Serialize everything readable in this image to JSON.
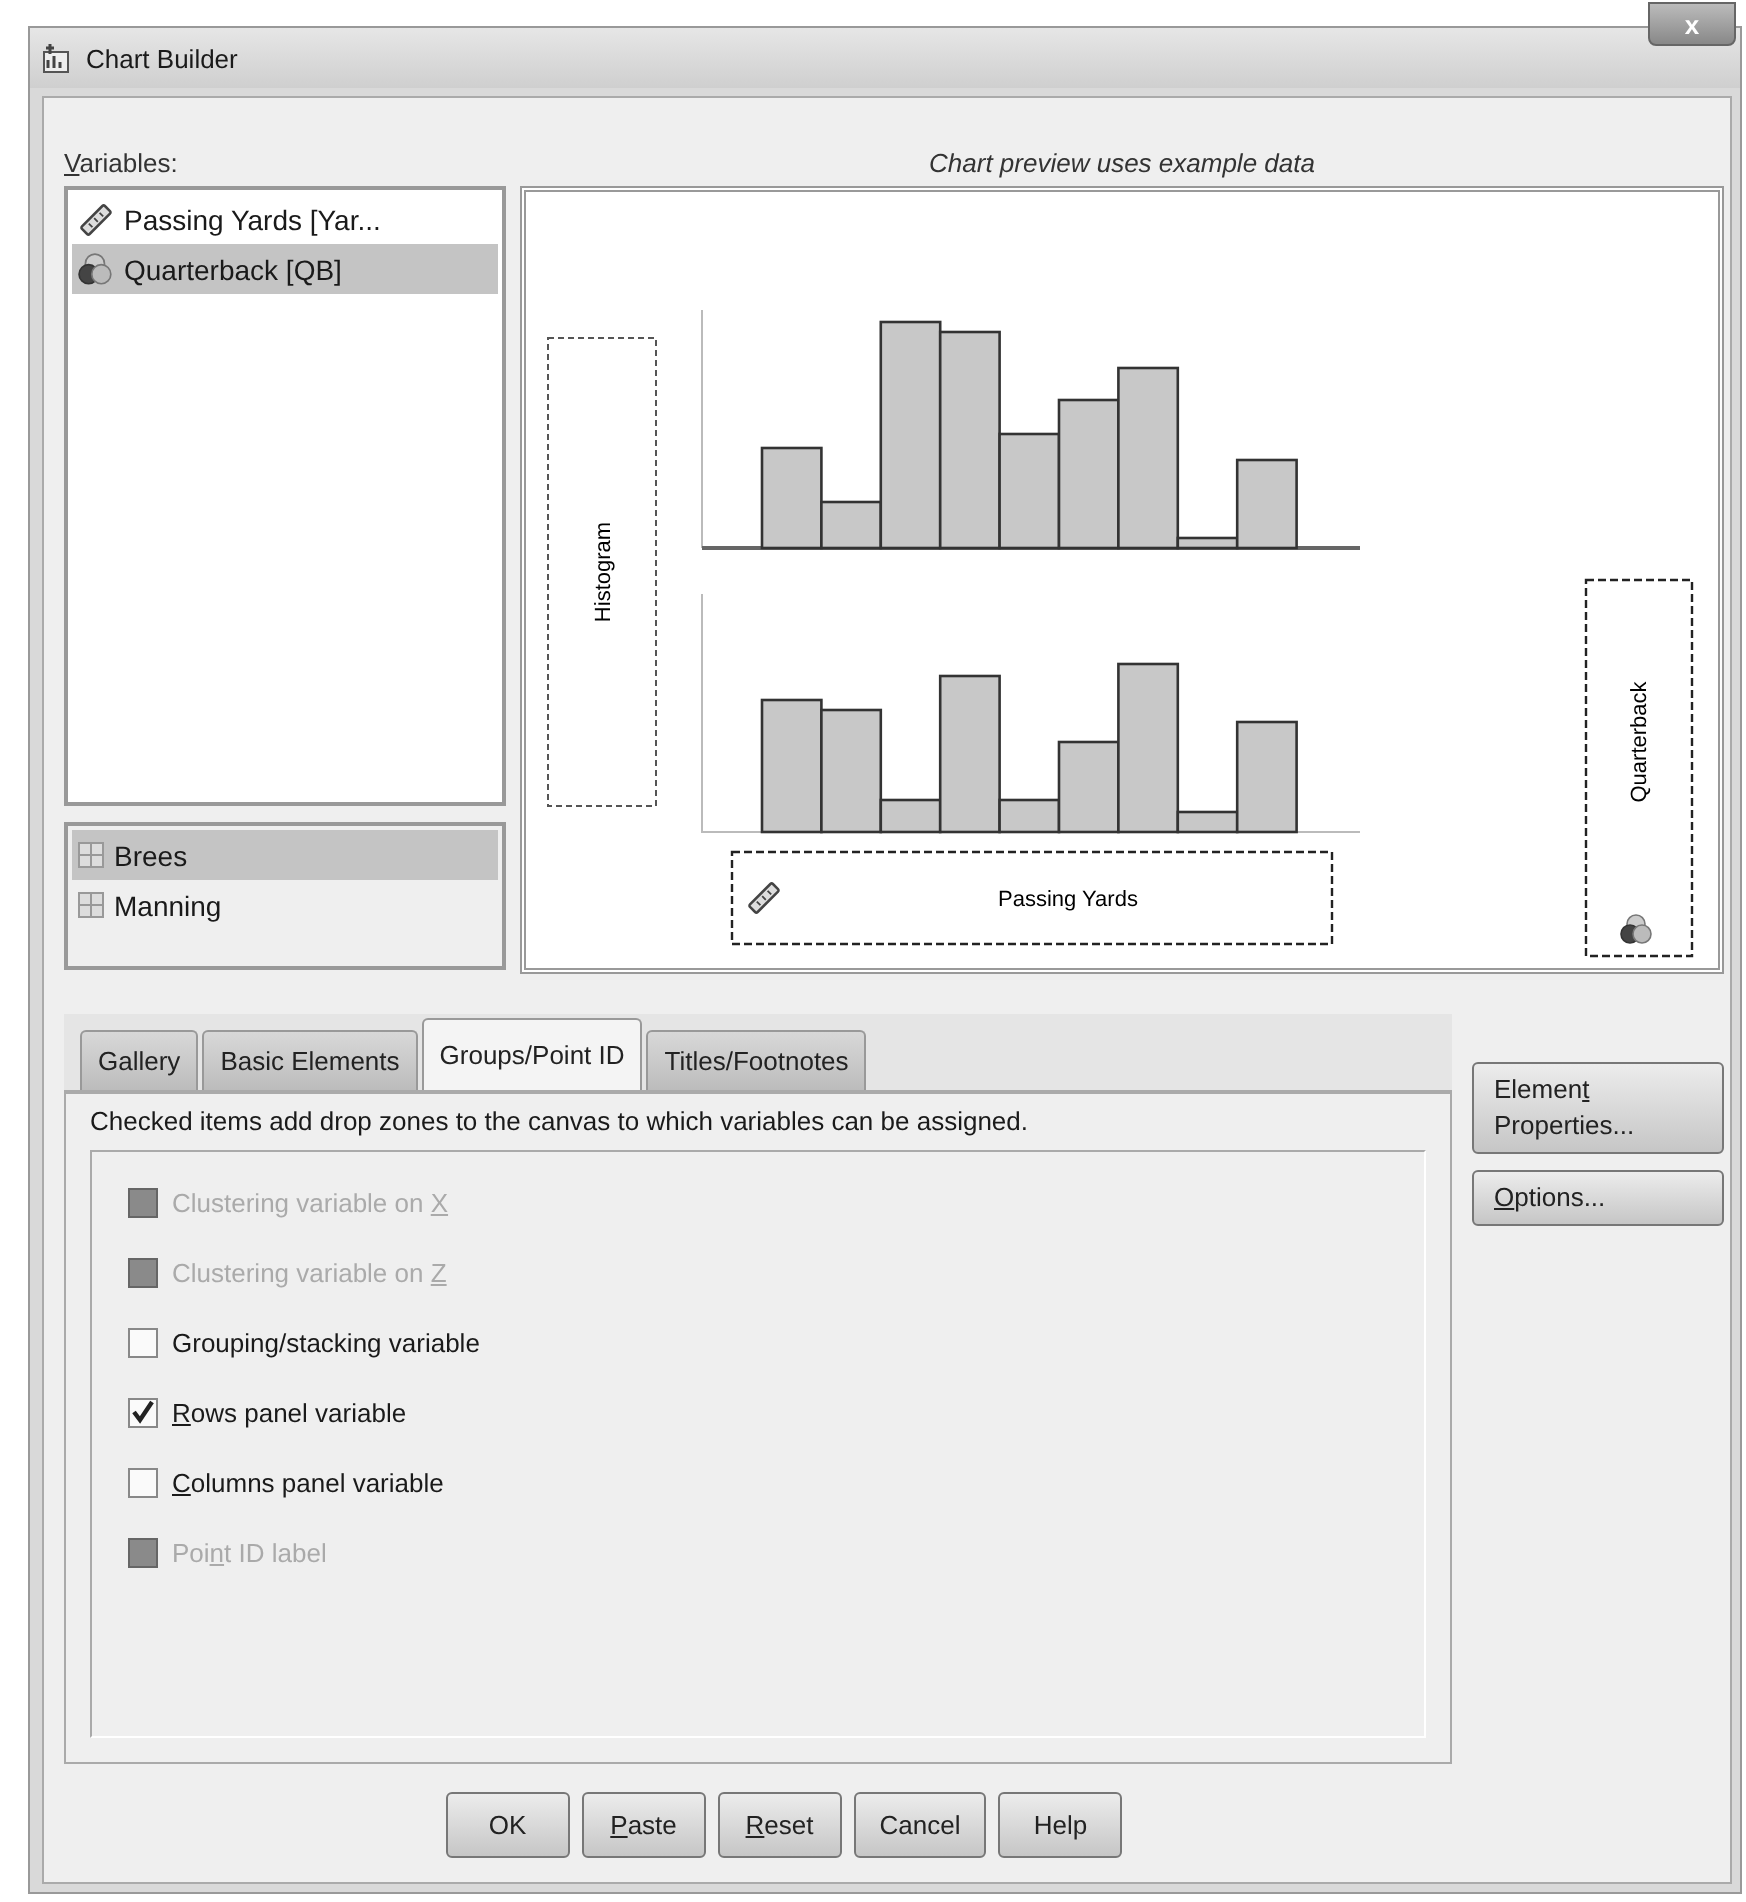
{
  "window": {
    "title": "Chart Builder",
    "close_label": "x"
  },
  "variables": {
    "label": [
      {
        "text": "V",
        "key": true
      },
      {
        "text": "ariables:",
        "key": false
      }
    ],
    "items": [
      {
        "name": "Passing Yards [Yar...",
        "kind": "scale",
        "selected": false
      },
      {
        "name": "Quarterback [QB]",
        "kind": "nominal",
        "selected": true
      }
    ]
  },
  "categories": [
    {
      "name": "Brees",
      "selected": true
    },
    {
      "name": "Manning",
      "selected": false
    }
  ],
  "preview": {
    "caption": "Chart preview uses example data",
    "y_zone": "Histogram",
    "x_zone": "Passing Yards",
    "panel_zone": "Quarterback"
  },
  "tabs": [
    {
      "label": "Gallery",
      "selected": false
    },
    {
      "label": "Basic Elements",
      "selected": false
    },
    {
      "label": "Groups/Point ID",
      "selected": true
    },
    {
      "label": "Titles/Footnotes",
      "selected": false
    }
  ],
  "panel": {
    "description": "Checked items add drop zones to the canvas to which variables can be assigned.",
    "options": [
      {
        "label": [
          {
            "text": "Clustering variable on ",
            "key": false
          },
          {
            "text": "X",
            "key": true
          }
        ],
        "checked": false,
        "disabled": true
      },
      {
        "label": [
          {
            "text": "Clustering variable on ",
            "key": false
          },
          {
            "text": "Z",
            "key": true
          }
        ],
        "checked": false,
        "disabled": true
      },
      {
        "label": [
          {
            "text": "Grouping/stacking variable",
            "key": false
          }
        ],
        "checked": false,
        "disabled": false
      },
      {
        "label": [
          {
            "text": "R",
            "key": true
          },
          {
            "text": "ows panel variable",
            "key": false
          }
        ],
        "checked": true,
        "disabled": false
      },
      {
        "label": [
          {
            "text": "C",
            "key": true
          },
          {
            "text": "olumns panel variable",
            "key": false
          }
        ],
        "checked": false,
        "disabled": false
      },
      {
        "label": [
          {
            "text": "Poi",
            "key": false
          },
          {
            "text": "n",
            "key": true
          },
          {
            "text": "t ID label",
            "key": false
          }
        ],
        "checked": false,
        "disabled": true
      }
    ]
  },
  "side_buttons": [
    {
      "label": [
        {
          "text": "Elemen",
          "key": false
        },
        {
          "text": "t",
          "key": true
        },
        {
          "text": " Properties...",
          "key": false
        }
      ]
    },
    {
      "label": [
        {
          "text": "O",
          "key": true
        },
        {
          "text": "ptions...",
          "key": false
        }
      ]
    }
  ],
  "buttons": [
    {
      "label": [
        {
          "text": "OK",
          "key": false
        }
      ]
    },
    {
      "label": [
        {
          "text": "P",
          "key": true
        },
        {
          "text": "aste",
          "key": false
        }
      ]
    },
    {
      "label": [
        {
          "text": "R",
          "key": true
        },
        {
          "text": "eset",
          "key": false
        }
      ]
    },
    {
      "label": [
        {
          "text": "Cancel",
          "key": false
        }
      ]
    },
    {
      "label": [
        {
          "text": "Help",
          "key": false
        }
      ]
    }
  ]
}
